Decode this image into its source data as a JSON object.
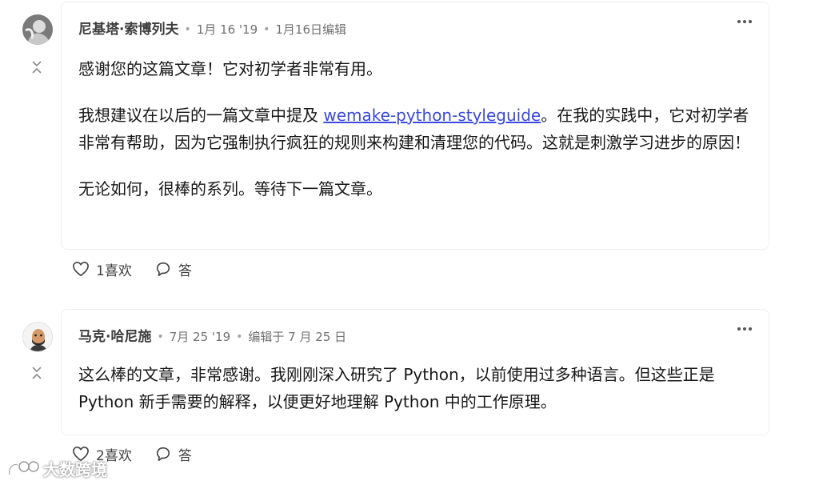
{
  "comments": [
    {
      "author": "尼基塔·索博列夫",
      "separator": "•",
      "date": "1月 16 '19",
      "edited": "1月16日编辑",
      "paragraphs": [
        {
          "text": "感谢您的这篇文章！它对初学者非常有用。"
        },
        {
          "before": "我想建议在以后的一篇文章中提及 ",
          "link": "wemake-python-styleguide",
          "after": "。在我的实践中，它对初学者非常有帮助，因为它强制执行疯狂的规则来构建和清理您的代码。这就是刺激学习进步的原因！"
        },
        {
          "text": "无论如何，很棒的系列。等待下一篇文章。"
        }
      ],
      "like_label": "1喜欢",
      "reply_label": "答"
    },
    {
      "author": "马克·哈尼施",
      "separator": "•",
      "date": "7月 25 '19",
      "edited": "编辑于 7 月 25 日",
      "paragraphs": [
        {
          "text": "这么棒的文章，非常感谢。我刚刚深入研究了 Python，以前使用过多种语言。但这些正是 Python 新手需要的解释，以便更好地理解 Python 中的工作原理。"
        }
      ],
      "like_label": "2喜欢",
      "reply_label": "答"
    }
  ],
  "watermark": "大数跨境",
  "icons": [
    "avatar",
    "collapse-icon",
    "more-options-icon",
    "heart-icon",
    "comment-icon"
  ]
}
